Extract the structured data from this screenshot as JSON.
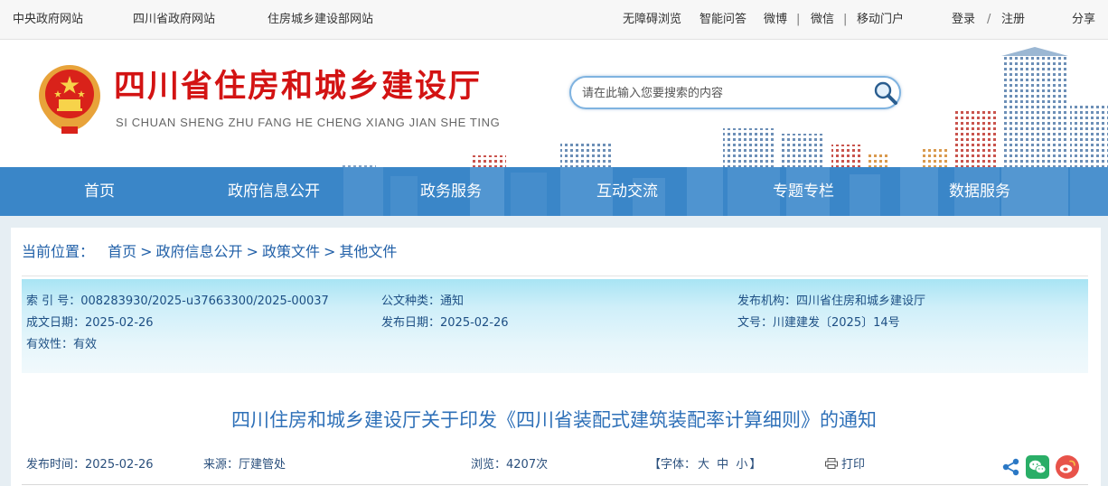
{
  "topbar": {
    "links": [
      "中央政府网站",
      "四川省政府网站",
      "住房城乡建设部网站"
    ],
    "accessibility": "无障碍浏览",
    "smart_qa": "智能问答",
    "weibo": "微博",
    "wechat": "微信",
    "mobile": "移动门户",
    "login": "登录",
    "slash": "/",
    "register": "注册",
    "share": "分享"
  },
  "header": {
    "title": "四川省住房和城乡建设厅",
    "pinyin": "SI CHUAN SHENG ZHU FANG HE CHENG XIANG JIAN SHE TING",
    "search_placeholder": "请在此输入您要搜索的内容"
  },
  "nav": {
    "items": [
      "首页",
      "政府信息公开",
      "政务服务",
      "互动交流",
      "专题专栏",
      "数据服务"
    ]
  },
  "breadcrumb": {
    "label": "当前位置：",
    "items": [
      "首页",
      "政府信息公开",
      "政策文件",
      "其他文件"
    ],
    "separator": ">"
  },
  "meta": {
    "index_no": "索 引 号：008283930/2025-u37663300/2025-00037",
    "doc_type": "公文种类：通知",
    "issuer": "发布机构：四川省住房和城乡建设厅",
    "written_date": "成文日期：2025-02-26",
    "publish_date": "发布日期：2025-02-26",
    "doc_number": "文号：川建建发〔2025〕14号",
    "validity": "有效性：有效"
  },
  "article": {
    "title": "四川住房和城乡建设厅关于印发《四川省装配式建筑装配率计算细则》的通知",
    "publish_time": "发布时间：2025-02-26",
    "source": "来源：厅建管处",
    "views": "浏览：4207次",
    "font_label_open": "【字体：",
    "font_large": "大",
    "font_medium": "中",
    "font_small": "小",
    "font_label_close": "】",
    "print": "打印"
  },
  "colors": {
    "nav_bg": "#3a86c8",
    "title_red": "#d31313",
    "link_blue": "#2160a8",
    "wechat_green": "#2aae67",
    "weibo_red": "#e8534a"
  },
  "icons": [
    "national-emblem-icon",
    "search-icon",
    "print-icon",
    "share-icon",
    "wechat-icon",
    "weibo-icon"
  ]
}
